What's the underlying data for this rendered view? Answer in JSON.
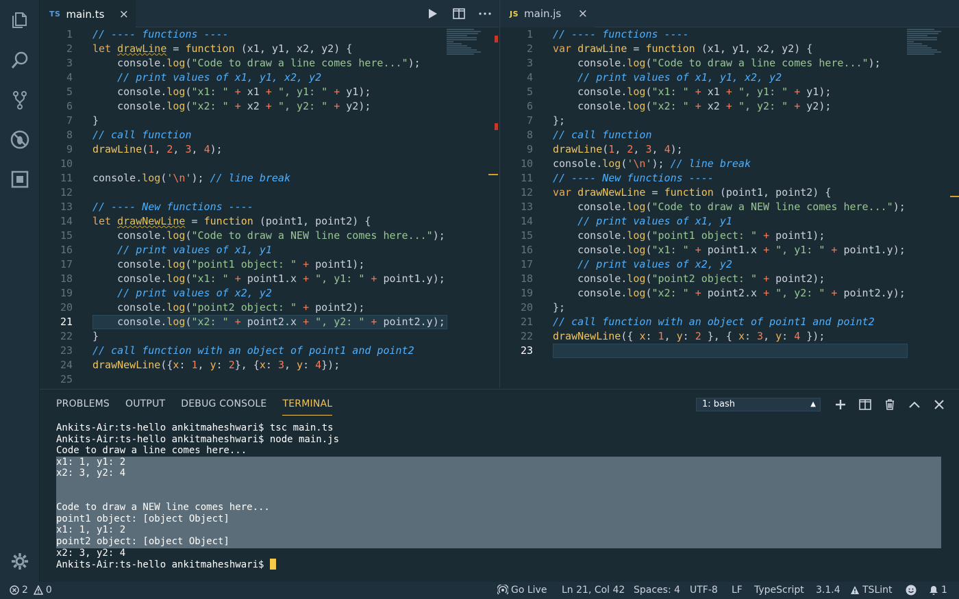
{
  "activity_bar": {
    "icons": [
      "files-icon",
      "search-icon",
      "source-control-icon",
      "debug-icon",
      "extensions-icon",
      "settings-gear-icon"
    ]
  },
  "left_editor": {
    "tab": {
      "lang": "TS",
      "filename": "main.ts",
      "close": "×"
    },
    "actions": [
      "run-icon",
      "split-editor-icon",
      "more-icon"
    ],
    "current_line": 21,
    "lines": [
      "// ---- functions ----",
      "let drawLine = function (x1, y1, x2, y2) {",
      "    console.log(\"Code to draw a line comes here...\");",
      "    // print values of x1, y1, x2, y2",
      "    console.log(\"x1: \" + x1 + \", y1: \" + y1);",
      "    console.log(\"x2: \" + x2 + \", y2: \" + y2);",
      "}",
      "// call function",
      "drawLine(1, 2, 3, 4);",
      "",
      "console.log('\\n'); // line break",
      "",
      "// ---- New functions ----",
      "let drawNewLine = function (point1, point2) {",
      "    console.log(\"Code to draw a NEW line comes here...\");",
      "    // print values of x1, y1",
      "    console.log(\"point1 object: \" + point1);",
      "    console.log(\"x1: \" + point1.x + \", y1: \" + point1.y);",
      "    // print values of x2, y2",
      "    console.log(\"point2 object: \" + point2);",
      "    console.log(\"x2: \" + point2.x + \", y2: \" + point2.y);",
      "}",
      "// call function with an object of point1 and point2",
      "drawNewLine({x: 1, y: 2}, {x: 3, y: 4});",
      ""
    ]
  },
  "right_editor": {
    "tab": {
      "lang": "JS",
      "filename": "main.js",
      "close": "×"
    },
    "current_line": 23,
    "lines": [
      "// ---- functions ----",
      "var drawLine = function (x1, y1, x2, y2) {",
      "    console.log(\"Code to draw a line comes here...\");",
      "    // print values of x1, y1, x2, y2",
      "    console.log(\"x1: \" + x1 + \", y1: \" + y1);",
      "    console.log(\"x2: \" + x2 + \", y2: \" + y2);",
      "};",
      "// call function",
      "drawLine(1, 2, 3, 4);",
      "console.log('\\n'); // line break",
      "// ---- New functions ----",
      "var drawNewLine = function (point1, point2) {",
      "    console.log(\"Code to draw a NEW line comes here...\");",
      "    // print values of x1, y1",
      "    console.log(\"point1 object: \" + point1);",
      "    console.log(\"x1: \" + point1.x + \", y1: \" + point1.y);",
      "    // print values of x2, y2",
      "    console.log(\"point2 object: \" + point2);",
      "    console.log(\"x2: \" + point2.x + \", y2: \" + point2.y);",
      "};",
      "// call function with an object of point1 and point2",
      "drawNewLine({ x: 1, y: 2 }, { x: 3, y: 4 });",
      ""
    ]
  },
  "panel": {
    "tabs": [
      "PROBLEMS",
      "OUTPUT",
      "DEBUG CONSOLE",
      "TERMINAL"
    ],
    "active_tab": "TERMINAL",
    "terminal_select": "1: bash",
    "actions": [
      "add-terminal-icon",
      "split-terminal-icon",
      "trash-icon",
      "maximize-panel-icon",
      "close-panel-icon"
    ],
    "terminal_lines": [
      "Ankits-Air:ts-hello ankitmaheshwari$ tsc main.ts",
      "Ankits-Air:ts-hello ankitmaheshwari$ node main.js",
      "Code to draw a line comes here...",
      "x1: 1, y1: 2",
      "x2: 3, y2: 4",
      "",
      "",
      "Code to draw a NEW line comes here...",
      "point1 object: [object Object]",
      "x1: 1, y1: 2",
      "point2 object: [object Object]",
      "x2: 3, y2: 4"
    ],
    "prompt": "Ankits-Air:ts-hello ankitmaheshwari$ "
  },
  "status_bar": {
    "errors": "2",
    "warnings": "0",
    "go_live": "Go Live",
    "position": "Ln 21, Col 42",
    "spaces": "Spaces: 4",
    "encoding": "UTF-8",
    "eol": "LF",
    "language": "TypeScript",
    "ts_version": "3.1.4",
    "tslint": "TSLint",
    "notifications": "1"
  },
  "colors": {
    "background": "#1b2b34",
    "accent_yellow": "#f2c55c",
    "comment_blue": "#4cb0ff",
    "string_green": "#99c794",
    "number_orange": "#f97b58"
  }
}
